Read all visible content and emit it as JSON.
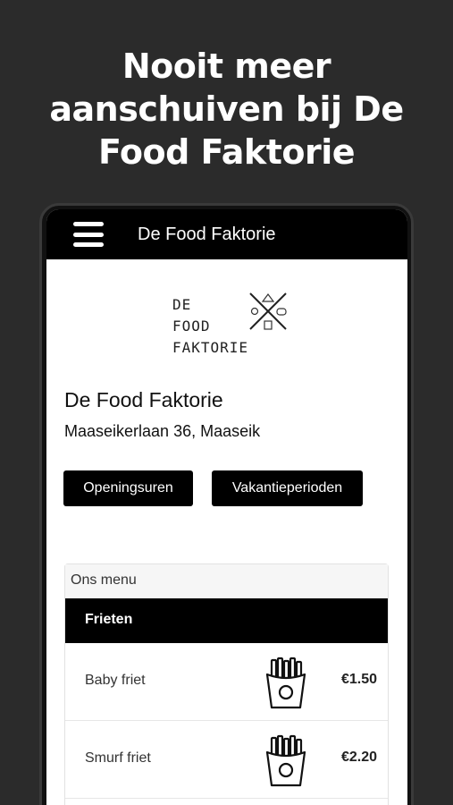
{
  "headline": [
    "Nooit meer",
    "aanschuiven bij De",
    "Food Faktorie"
  ],
  "appbar": {
    "title": "De Food Faktorie",
    "menu_icon": "hamburger-icon"
  },
  "logo": {
    "lines": [
      "DE",
      "FOOD",
      "FAKTORIE"
    ]
  },
  "venue": {
    "name": "De Food Faktorie",
    "address": "Maaseikerlaan 36, Maaseik"
  },
  "buttons": {
    "hours": "Openingsuren",
    "holidays": "Vakantieperioden"
  },
  "menu": {
    "title": "Ons menu",
    "category": "Frieten",
    "items": [
      {
        "name": "Baby friet",
        "price": "€1.50",
        "icon": "fries-icon"
      },
      {
        "name": "Smurf friet",
        "price": "€2.20",
        "icon": "fries-icon"
      }
    ]
  },
  "colors": {
    "background": "#2b2b2b",
    "appbar": "#000000",
    "accent": "#000000"
  }
}
